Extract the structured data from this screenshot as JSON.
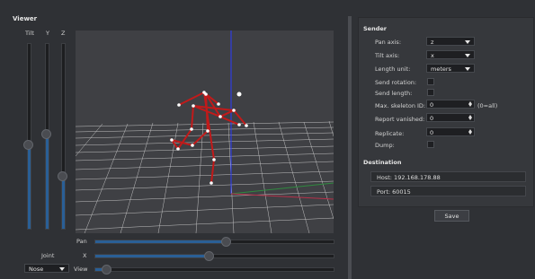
{
  "viewer": {
    "title": "Viewer",
    "vertical_sliders": [
      {
        "label": "Tilt",
        "value": 0.45
      },
      {
        "label": "Y",
        "value": 0.51
      },
      {
        "label": "Z",
        "value": 0.28
      }
    ],
    "pan": {
      "label": "Pan",
      "value": 0.55
    },
    "x": {
      "label": "X",
      "value": 0.48
    },
    "view": {
      "label": "View",
      "value": 0.05
    },
    "joint": {
      "label": "Joint",
      "selected": "Nose"
    }
  },
  "sender": {
    "title": "Sender",
    "pan_axis": {
      "label": "Pan axis:",
      "value": "z"
    },
    "tilt_axis": {
      "label": "Tilt axis:",
      "value": "x"
    },
    "length_unit": {
      "label": "Length unit:",
      "value": "meters"
    },
    "send_rotation": {
      "label": "Send rotation:",
      "checked": false
    },
    "send_length": {
      "label": "Send length:",
      "checked": false
    },
    "max_skeleton": {
      "label": "Max. skeleton ID:",
      "value": "0",
      "suffix": "(0=all)"
    },
    "report_vanished": {
      "label": "Report vanished:",
      "value": "0"
    },
    "replicate": {
      "label": "Replicate:",
      "value": "0"
    },
    "dump": {
      "label": "Dump:",
      "checked": false
    }
  },
  "destination": {
    "title": "Destination",
    "host": "Host:  192.168.178.88",
    "port": "Port:  60015"
  },
  "save_label": "Save",
  "colors": {
    "accent": "#2a5f96",
    "skeleton": "#c21a1a",
    "axis_blue": "#2b3cff",
    "axis_green": "#2f8a3f",
    "axis_red": "#b8304a"
  }
}
